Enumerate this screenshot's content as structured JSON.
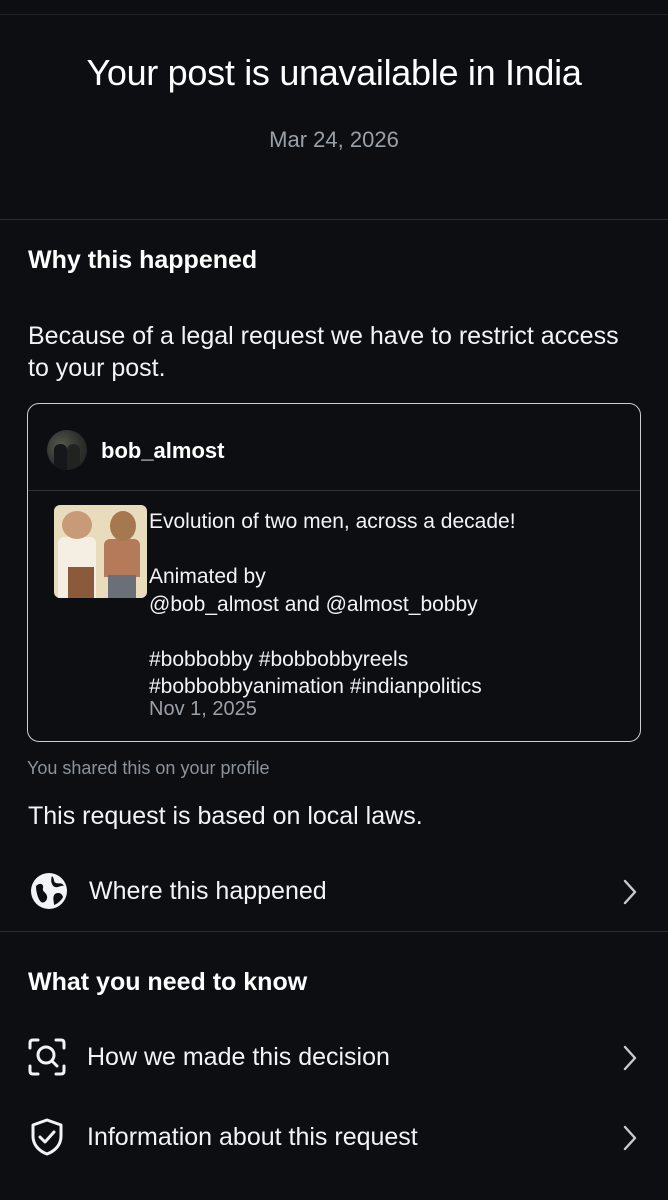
{
  "header": {
    "title": "Your post is unavailable in India",
    "date": "Mar 24, 2026"
  },
  "why": {
    "heading": "Why this happened",
    "reason": "Because of a legal request we have to restrict access to your post."
  },
  "post": {
    "username": "bob_almost",
    "caption": "Evolution of two men, across a decade!\n\nAnimated by\n@bob_almost and @almost_bobby\n\n#bobbobby #bobbobbyreels\n#bobbobbyanimation #indianpolitics",
    "date": "Nov 1, 2025"
  },
  "shared_note": "You shared this on your profile",
  "local_laws": "This request is based on local laws.",
  "where_row": {
    "label": "Where this happened",
    "icon": "globe-icon"
  },
  "know": {
    "heading": "What you need to know",
    "items": [
      {
        "label": "How we made this decision",
        "icon": "search-scan-icon"
      },
      {
        "label": "Information about this request",
        "icon": "shield-check-icon"
      }
    ]
  },
  "colors": {
    "background": "#0c0e12",
    "text": "#f2f3f5",
    "muted": "#9aa0a8",
    "divider": "#2a2d33",
    "card_border": "#c9ccd1"
  }
}
